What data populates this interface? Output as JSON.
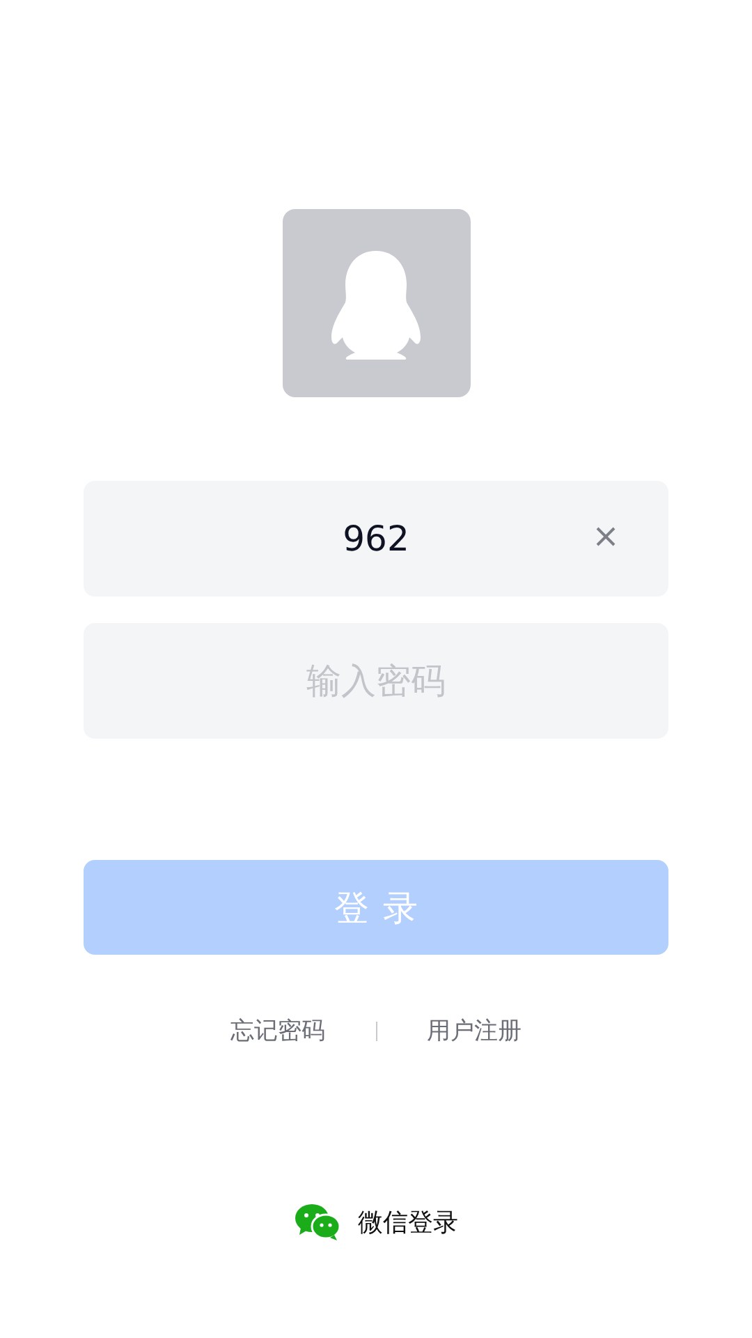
{
  "account_field": {
    "value": "962"
  },
  "password_field": {
    "placeholder": "输入密码"
  },
  "login_button": {
    "label": "登录",
    "disabled": true
  },
  "links": [
    {
      "label": "忘记密码"
    },
    {
      "label": "用户注册"
    }
  ],
  "wechat_login": {
    "label": "微信登录"
  }
}
